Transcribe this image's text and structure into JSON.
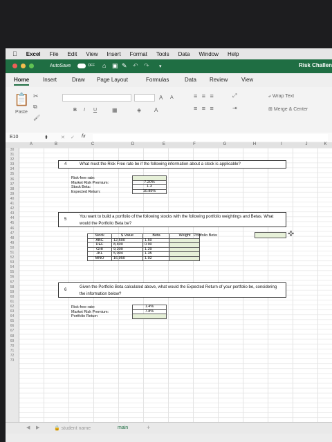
{
  "menubar": {
    "apple": "",
    "app": "Excel",
    "items": [
      "File",
      "Edit",
      "View",
      "Insert",
      "Format",
      "Tools",
      "Data",
      "Window",
      "Help"
    ]
  },
  "titlebar": {
    "autosave": "AutoSave",
    "toggle": "OFF",
    "right": "Risk Challen"
  },
  "ribbon_tabs": [
    "Home",
    "Insert",
    "Draw",
    "Page Layout",
    "Formulas",
    "Data",
    "Review",
    "View"
  ],
  "ribbon": {
    "paste": "Paste",
    "bold": "B",
    "italic": "I",
    "underline": "U",
    "grow_font": "A",
    "shrink_font": "A",
    "wrap_text": "Wrap Text",
    "merge_center": "Merge & Center"
  },
  "formula_bar": {
    "name_box": "E10",
    "cancel": "✕",
    "enter": "✓",
    "fx": "fx"
  },
  "columns": [
    "A",
    "B",
    "C",
    "D",
    "E",
    "F",
    "G",
    "H",
    "I",
    "J",
    "K"
  ],
  "rows": [
    "30",
    "31",
    "32",
    "33",
    "34",
    "35",
    "36",
    "37",
    "38",
    "39",
    "40",
    "41",
    "42",
    "43",
    "44",
    "45",
    "46",
    "47",
    "48",
    "49",
    "50",
    "51",
    "52",
    "53",
    "54",
    "55",
    "56",
    "57",
    "58",
    "59",
    "60",
    "61",
    "62",
    "63",
    "64",
    "65",
    "66",
    "67",
    "68",
    "69",
    "70",
    "71",
    "72",
    "73"
  ],
  "q4": {
    "num": "4",
    "text": "What must the Risk Free rate be if the following information about a stock is applicable?",
    "labels": [
      "Risk-free rate:",
      "Market Risk Premium:",
      "Stock Beta:",
      "Expected Return:"
    ],
    "values": [
      "",
      "7.20%",
      "1.3",
      "10.85%"
    ]
  },
  "q5": {
    "num": "5",
    "text": "You want to build a portfolio of the following stocks with the following portfolio weightings and Betas.  What would the Portfolio Beta be?",
    "headers": [
      "Stock",
      "$ Value",
      "Beta",
      "Weight"
    ],
    "rows": [
      [
        "ABC",
        "12,500",
        "1.50",
        ""
      ],
      [
        "DEF",
        "8,400",
        "0.90",
        ""
      ],
      [
        "GHI",
        "9,200",
        "1.20",
        ""
      ],
      [
        "JKL",
        "5,004",
        "1.35",
        ""
      ],
      [
        "MNO",
        "16,950",
        "1.92",
        ""
      ]
    ],
    "portfolio_beta_label": "Portfolio Beta:"
  },
  "q6": {
    "num": "6",
    "text": "Given the Portfolio Beta calculated above, what would the Expected Return of your portfolio be, considering the information below?",
    "labels": [
      "Risk-free rate:",
      "Market Risk Premium:",
      "Portfolio Return"
    ],
    "values": [
      "1.4%",
      "7.8%",
      ""
    ]
  },
  "sheet_tabs": {
    "tab1": "student name",
    "tab2": "main",
    "add": "+"
  }
}
